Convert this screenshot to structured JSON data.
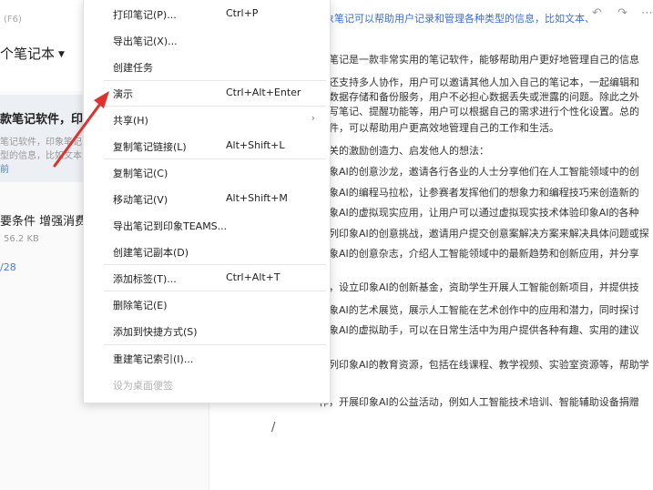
{
  "left": {
    "shortcut_hint": "(F6)",
    "notebook_title": "个笔记本",
    "card1": {
      "title": "款笔记软件，印象",
      "line1": "笔记软件，印象笔记",
      "line2": "型的信息，比如文本",
      "line3": "前"
    },
    "card2": {
      "title": "要条件 增强消费后",
      "size": "56.2 KB"
    },
    "pagination": "/28"
  },
  "editor": {
    "header": "象笔记可以帮助用户记录和管理各种类型的信息，比如文本、",
    "undo_icon": "↶",
    "redo_icon": "↷",
    "more_icon": "⋯",
    "lines": [
      "象笔记是一款非常实用的笔记软件，能够帮助用户更好地管理自己的信息",
      "记还支持多人协作，用户可以邀请其他人加入自己的笔记本，一起编辑和",
      "的数据存储和备份服务，用户不必担心数据丢失或泄露的问题。除此之外",
      "手写笔记、提醒功能等，用户可以根据自己的需求进行个性化设置。总的",
      "软件，可以帮助用户更高效地管理自己的工作和生活。",
      "相关的激励创造力、启发他人的想法：",
      "印象AI的创意沙龙，邀请各行各业的人士分享他们在人工智能领域中的创",
      "印象AI的编程马拉松，让参赛者发挥他们的想象力和编程技巧来创造新的",
      "印象AI的虚拟现实应用，让用户可以通过虚拟现实技术体验印象AI的各种",
      "系列印象AI的创意挑战，邀请用户提交创意案解决方案来解决具体问题或探",
      "印象AI的创意杂志，介绍人工智能领域中的最新趋势和创新应用，并分享",
      "作，设立印象AI的创新基金，资助学生开展人工智能创新项目，并提供技",
      "印象AI的艺术展览，展示人工智能在艺术创作中的应用和潜力，同时探讨",
      "印象AI的虚拟助手，可以在日常生活中为用户提供各种有趣、实用的建议",
      "系列印象AI的教育资源，包括在线课程、教学视频、实验室资源等，帮助学",
      "作，开展印象AI的公益活动，例如人工智能技术培训、智能辅助设备捐赠"
    ],
    "cursor_mark": "/"
  },
  "menu": {
    "items": [
      {
        "label": "打印笔记(P)...",
        "shortcut": "Ctrl+P"
      },
      {
        "label": "导出笔记(X)..."
      },
      {
        "label": "创建任务"
      },
      {
        "label": "演示",
        "shortcut": "Ctrl+Alt+Enter"
      },
      {
        "label": "共享(H)",
        "submenu": "›"
      },
      {
        "label": "复制笔记链接(L)",
        "shortcut": "Alt+Shift+L"
      },
      {
        "label": "复制笔记(C)"
      },
      {
        "label": "移动笔记(V)",
        "shortcut": "Alt+Shift+M"
      },
      {
        "label": "导出笔记到印象TEAMS..."
      },
      {
        "label": "创建笔记副本(D)"
      },
      {
        "label": "添加标签(T)...",
        "shortcut": "Ctrl+Alt+T"
      },
      {
        "label": "删除笔记(E)"
      },
      {
        "label": "添加到快捷方式(S)"
      },
      {
        "label": "重建笔记索引(I)..."
      },
      {
        "label": "设为桌面便签"
      }
    ]
  },
  "colors": {
    "accent_blue": "#3a6fd8",
    "arrow_red": "#e0312b"
  }
}
